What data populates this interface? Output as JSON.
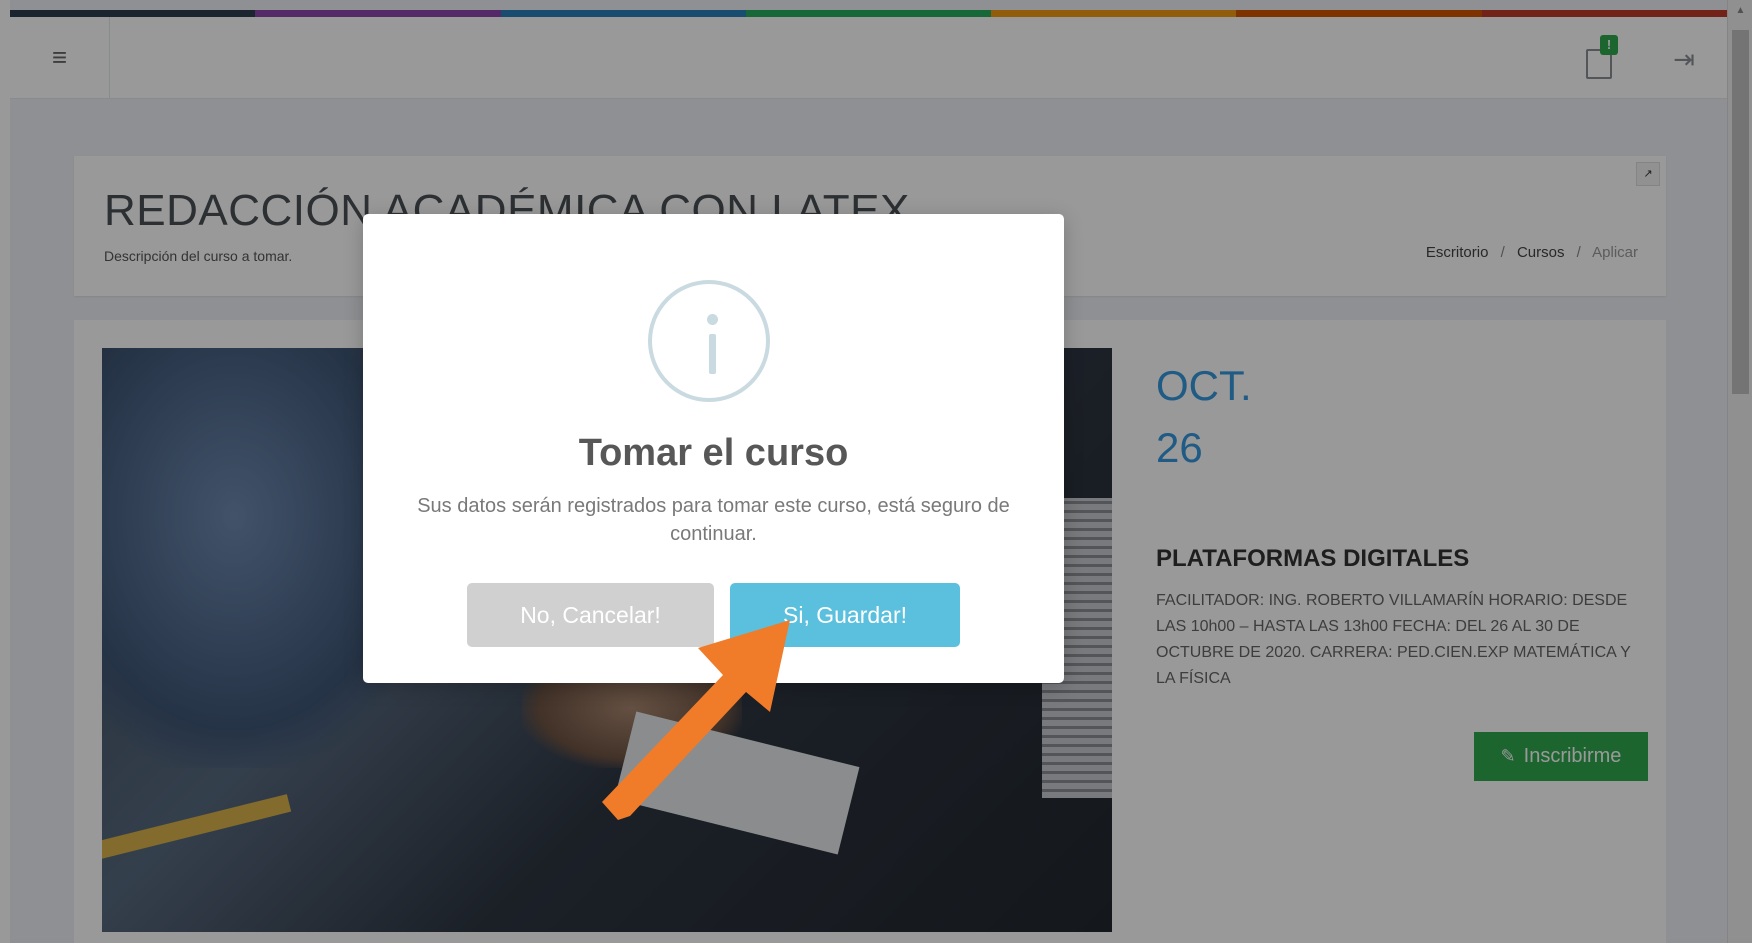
{
  "page": {
    "stripe_colors": [
      "#2c3e50",
      "#8e44ad",
      "#2980b9",
      "#27ae60",
      "#f39c12",
      "#d35400",
      "#c0392b"
    ]
  },
  "topbar": {
    "menu_icon": "hamburger-icon",
    "notification_badge": "!",
    "notification_icon": "notification-document-icon",
    "logout_icon": "sign-out-icon"
  },
  "header": {
    "title": "REDACCIÓN ACADÉMICA CON LATEX",
    "description": "Descripción del curso a tomar.",
    "breadcrumb": [
      {
        "label": "Escritorio"
      },
      {
        "label": "Cursos"
      },
      {
        "label": "Aplicar"
      }
    ],
    "separator": "/",
    "expand_icon": "expand-icon"
  },
  "course": {
    "month": "OCT.",
    "day": "26",
    "section_title": "PLATAFORMAS DIGITALES",
    "details": "FACILITADOR: ING. ROBERTO VILLAMARÍN HORARIO: DESDE LAS 10h00 – HASTA LAS 13h00 FECHA: DEL 26 AL 30 DE OCTUBRE DE 2020. CARRERA: PED.CIEN.EXP MATEMÁTICA Y LA FÍSICA",
    "enroll_label": "Inscribirme",
    "enroll_icon": "pencil-icon",
    "enroll_color": "#2fa84f"
  },
  "modal": {
    "icon": "info-icon",
    "title": "Tomar el curso",
    "text": "Sus datos serán registrados para tomar este curso, está seguro de continuar.",
    "cancel_label": "No, Cancelar!",
    "confirm_label": "Si, Guardar!",
    "confirm_color": "#5bc0de",
    "cancel_color": "#d0d0d0"
  },
  "annotation": {
    "arrow_icon": "orange-arrow-icon",
    "arrow_color": "#f07c2a"
  }
}
